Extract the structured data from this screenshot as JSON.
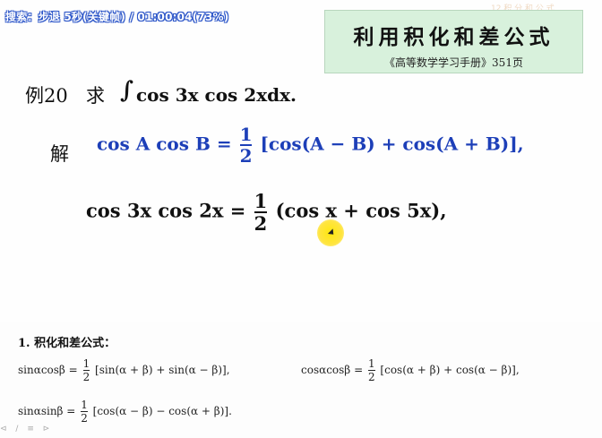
{
  "overlay": {
    "status": "搜索：步退 5秒(关键帧) / 01:00:04(73%)",
    "faint_text": "12 积 分 和 公 式"
  },
  "title_box": {
    "main": "利用积化和差公式",
    "sub": "《高等数学学习手册》351页"
  },
  "example": {
    "label": "例20",
    "qiu": "求",
    "integral_sign": "∫",
    "expr": "cos 3x cos 2xdx."
  },
  "solution": {
    "label": "解",
    "f1_lhs": "cos A cos B =",
    "f1_num": "1",
    "f1_den": "2",
    "f1_rhs": "[cos(A − B) + cos(A + B)],",
    "f2_lhs": "cos 3x cos 2x =",
    "f2_num": "1",
    "f2_den": "2",
    "f2_rhs": "(cos x + cos 5x),"
  },
  "bottom": {
    "heading": "1. 积化和差公式：",
    "r1a_lhs": "sinαcosβ =",
    "r1a_num": "1",
    "r1a_den": "2",
    "r1a_rhs": "[sin(α + β) + sin(α − β)],",
    "r1b_lhs": "cosαcosβ =",
    "r1b_num": "1",
    "r1b_den": "2",
    "r1b_rhs": "[cos(α + β) + cos(α − β)],",
    "r2_lhs": "sinαsinβ =",
    "r2_num": "1",
    "r2_den": "2",
    "r2_rhs": "[cos(α − β) − cos(α + β)]."
  },
  "player_icons": [
    "prev-icon",
    "edit-icon",
    "list-icon",
    "next-icon"
  ]
}
